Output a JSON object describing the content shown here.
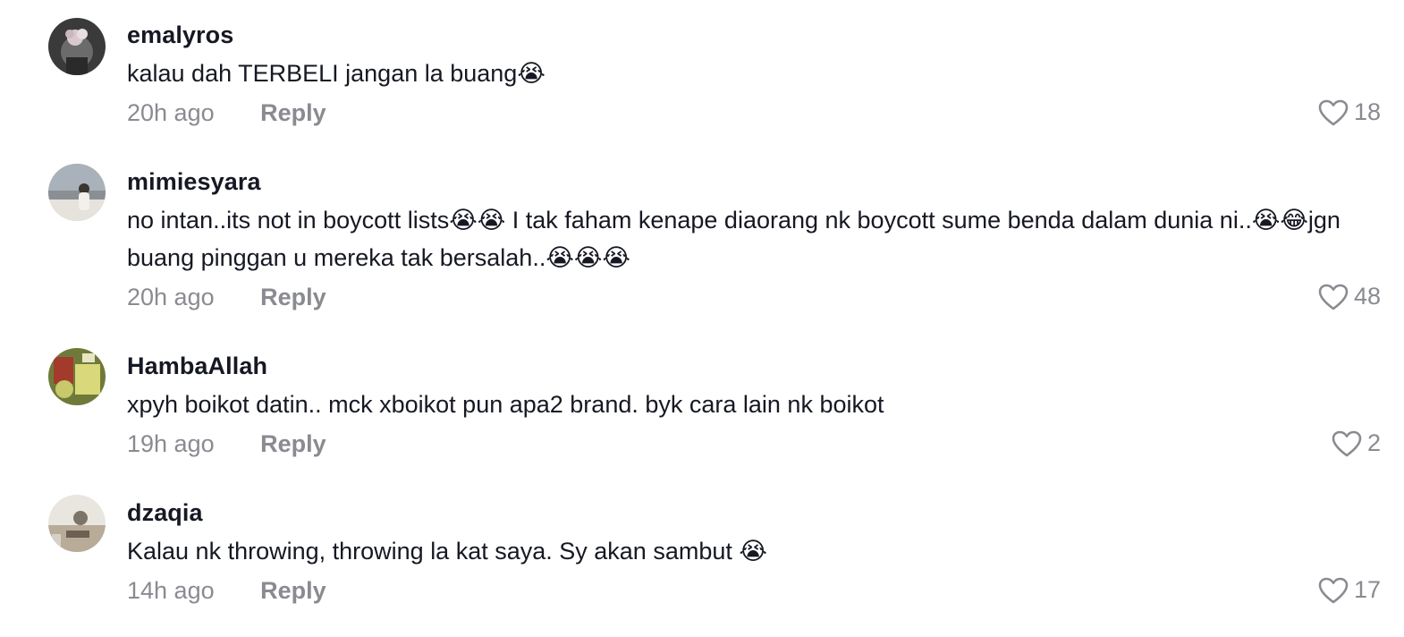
{
  "comments": [
    {
      "username": "emalyros",
      "text": "kalau dah TERBELI jangan la buang😭",
      "time": "20h ago",
      "reply_label": "Reply",
      "likes": "18"
    },
    {
      "username": "mimiesyara",
      "text": "no intan..its not in boycott lists😭😭 I tak faham kenape diaorang nk boycott sume benda dalam dunia ni..😭😂jgn buang pinggan u mereka tak bersalah..😭😭😭",
      "time": "20h ago",
      "reply_label": "Reply",
      "likes": "48"
    },
    {
      "username": "HambaAllah",
      "text": "xpyh boikot datin.. mck xboikot pun apa2 brand. byk cara lain nk boikot",
      "time": "19h ago",
      "reply_label": "Reply",
      "likes": "2"
    },
    {
      "username": "dzaqia",
      "text": "Kalau nk throwing, throwing la kat saya. Sy akan sambut 😭",
      "time": "14h ago",
      "reply_label": "Reply",
      "likes": "17"
    }
  ],
  "colors": {
    "text_primary": "#161823",
    "text_secondary": "#8a8b91",
    "background": "#ffffff"
  },
  "icons": {
    "like": "heart-outline-icon"
  }
}
